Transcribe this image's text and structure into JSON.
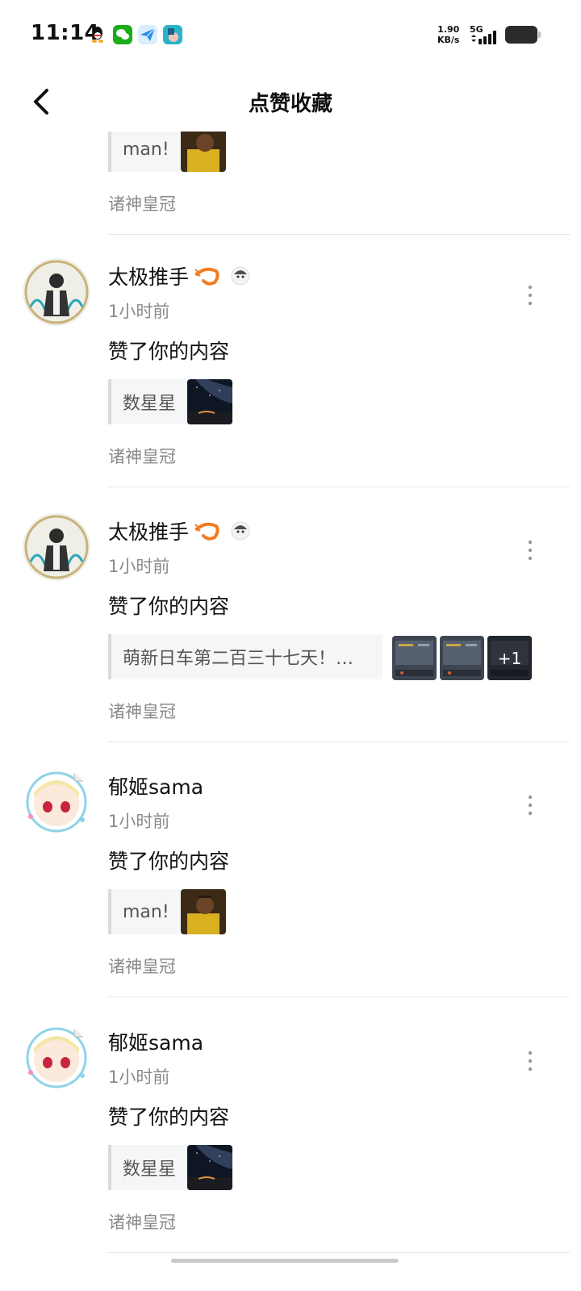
{
  "status_bar": {
    "time": "11:14",
    "net_speed_value": "1.90",
    "net_speed_unit": "KB/s",
    "network": "5G",
    "icons": [
      "qq-icon",
      "wechat-icon",
      "telegram-icon",
      "app-icon"
    ]
  },
  "header": {
    "title": "点赞收藏",
    "back_icon": "chevron-left-icon"
  },
  "notifications": [
    {
      "partial": true,
      "quote_text": "man!",
      "source": "诸神皇冠"
    },
    {
      "user": "太极推手",
      "badges": [
        "shrimp-icon",
        "avatar-badge-icon"
      ],
      "time": "1小时前",
      "action": "赞了你的内容",
      "quote_text": "数星星",
      "thumbs": [
        "night-sky-photo"
      ],
      "source": "诸神皇冠"
    },
    {
      "user": "太极推手",
      "badges": [
        "shrimp-icon",
        "avatar-badge-icon"
      ],
      "time": "1小时前",
      "action": "赞了你的内容",
      "quote_text": "萌新日车第二百三十七天！…",
      "thumbs": [
        "game-screenshot",
        "game-screenshot",
        "game-screenshot"
      ],
      "more_count": "+1",
      "source": "诸神皇冠"
    },
    {
      "user": "郁姬sama",
      "time": "1小时前",
      "action": "赞了你的内容",
      "quote_text": "man!",
      "thumbs": [
        "basketball-player-photo"
      ],
      "source": "诸神皇冠"
    },
    {
      "user": "郁姬sama",
      "time": "1小时前",
      "action": "赞了你的内容",
      "quote_text": "数星星",
      "thumbs": [
        "night-sky-photo"
      ],
      "source": "诸神皇冠"
    }
  ],
  "colors": {
    "text_primary": "#111111",
    "text_secondary": "#8a8a8a",
    "quote_bg": "#f5f6f8",
    "divider": "#e6e6e6"
  }
}
